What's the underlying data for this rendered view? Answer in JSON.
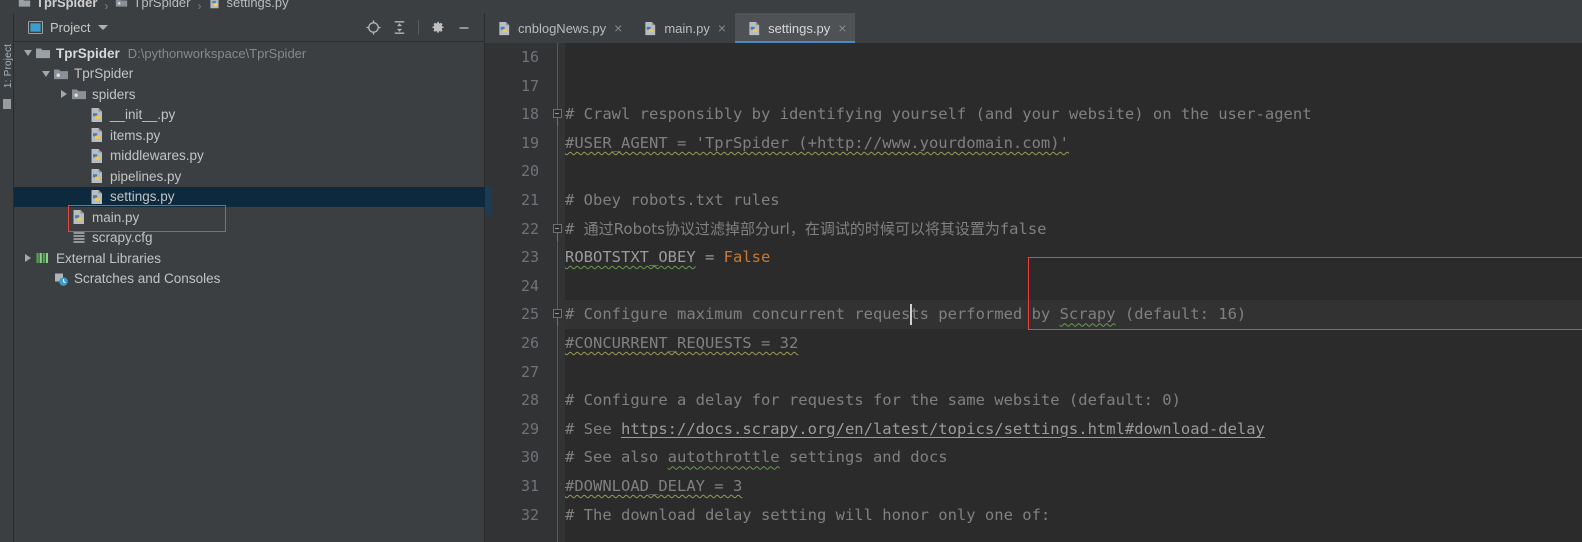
{
  "window": {
    "breadcrumb": [
      {
        "label": "TprSpider",
        "icon": "folder-icon",
        "bold": true
      },
      {
        "label": "TprSpider",
        "icon": "module-folder-icon",
        "bold": false
      },
      {
        "label": "settings.py",
        "icon": "python-file-icon",
        "bold": false
      }
    ],
    "separator": "›",
    "tool_window_label": "1: Project"
  },
  "project_panel": {
    "title": "Project",
    "title_icon": "project-view-icon",
    "dropdown_icon": "chevron-down-icon",
    "toolbar": [
      {
        "name": "locate-icon",
        "tooltip": "Select Opened File"
      },
      {
        "name": "collapse-all-icon",
        "tooltip": "Collapse All"
      },
      {
        "name": "gear-icon",
        "tooltip": "Settings"
      },
      {
        "name": "minimize-icon",
        "tooltip": "Hide"
      }
    ],
    "tree": [
      {
        "label": "TprSpider",
        "path": "D:\\pythonworkspace\\TprSpider",
        "icon": "folder-icon",
        "indent": 0,
        "arrow": "down",
        "bold": true,
        "selected": false
      },
      {
        "label": "TprSpider",
        "path": "",
        "icon": "module-folder-icon",
        "indent": 1,
        "arrow": "down",
        "bold": false,
        "selected": false
      },
      {
        "label": "spiders",
        "path": "",
        "icon": "module-folder-icon",
        "indent": 2,
        "arrow": "right",
        "bold": false,
        "selected": false
      },
      {
        "label": "__init__.py",
        "path": "",
        "icon": "python-file-icon",
        "indent": 3,
        "arrow": "none",
        "bold": false,
        "selected": false
      },
      {
        "label": "items.py",
        "path": "",
        "icon": "python-file-icon",
        "indent": 3,
        "arrow": "none",
        "bold": false,
        "selected": false
      },
      {
        "label": "middlewares.py",
        "path": "",
        "icon": "python-file-icon",
        "indent": 3,
        "arrow": "none",
        "bold": false,
        "selected": false
      },
      {
        "label": "pipelines.py",
        "path": "",
        "icon": "python-file-icon",
        "indent": 3,
        "arrow": "none",
        "bold": false,
        "selected": false
      },
      {
        "label": "settings.py",
        "path": "",
        "icon": "python-file-icon",
        "indent": 3,
        "arrow": "none",
        "bold": false,
        "selected": true
      },
      {
        "label": "main.py",
        "path": "",
        "icon": "python-file-icon",
        "indent": 2,
        "arrow": "none",
        "bold": false,
        "selected": false
      },
      {
        "label": "scrapy.cfg",
        "path": "",
        "icon": "config-file-icon",
        "indent": 2,
        "arrow": "none",
        "bold": false,
        "selected": false
      },
      {
        "label": "External Libraries",
        "path": "",
        "icon": "libraries-icon",
        "indent": 0,
        "arrow": "right",
        "bold": false,
        "selected": false
      },
      {
        "label": "Scratches and Consoles",
        "path": "",
        "icon": "scratches-icon",
        "indent": 1,
        "arrow": "none",
        "bold": false,
        "selected": false
      }
    ]
  },
  "editor": {
    "tabs": [
      {
        "label": "cnblogNews.py",
        "icon": "python-file-icon",
        "active": false,
        "close_icon": "close-icon"
      },
      {
        "label": "main.py",
        "icon": "python-file-icon",
        "active": false,
        "close_icon": "close-icon"
      },
      {
        "label": "settings.py",
        "icon": "python-file-icon",
        "active": true,
        "close_icon": "close-icon"
      }
    ],
    "first_line_number": 16,
    "current_line": 25,
    "lines": [
      {
        "n": "16",
        "text": ""
      },
      {
        "n": "17",
        "text": ""
      },
      {
        "n": "18",
        "text": "# Crawl responsibly by identifying yourself (and your website) on the user-agent"
      },
      {
        "n": "19",
        "text": "#USER_AGENT = 'TprSpider (+http://www.yourdomain.com)'"
      },
      {
        "n": "20",
        "text": ""
      },
      {
        "n": "21",
        "text": "# Obey robots.txt rules"
      },
      {
        "n": "22",
        "text": "# 通过Robots协议过滤掉部分url，在调试的时候可以将其设置为false"
      },
      {
        "n": "23",
        "text": "ROBOTSTXT_OBEY = False"
      },
      {
        "n": "24",
        "text": ""
      },
      {
        "n": "25",
        "text": "# Configure maximum concurrent requests performed by Scrapy (default: 16)"
      },
      {
        "n": "26",
        "text": "#CONCURRENT_REQUESTS = 32"
      },
      {
        "n": "27",
        "text": ""
      },
      {
        "n": "28",
        "text": "# Configure a delay for requests for the same website (default: 0)"
      },
      {
        "n": "29",
        "text": "# See https://docs.scrapy.org/en/latest/topics/settings.html#download-delay"
      },
      {
        "n": "30",
        "text": "# See also autothrottle settings and docs"
      },
      {
        "n": "31",
        "text": "#DOWNLOAD_DELAY = 3"
      },
      {
        "n": "32",
        "text": "# The download delay setting will honor only one of:"
      }
    ],
    "tokens": {
      "l22_hash": "# ",
      "l22_cjk": "通过Robots协议过滤掉部分url，在调试的时候可以将其设置为",
      "l22_false": "false",
      "l23_name": "ROBOTSTXT_OBEY",
      "l23_eq": " = ",
      "l23_value": "False",
      "l25_a": "# Configure maximum concurrent reques",
      "l25_b": "ts performed by ",
      "l25_scrapy": "Scrapy",
      "l25_c": " (default: 16)",
      "l29_a": "# See ",
      "l29_url": "https://docs.scrapy.org/en/latest/topics/settings.html#download-delay",
      "l30_a": "# See also ",
      "l30_word": "autothrottle",
      "l30_b": " settings and docs"
    }
  },
  "annotations": {
    "highlight_color": "#f1403f",
    "boxes": [
      {
        "name": "tree-settings-highlight",
        "target": "settings.py tree row"
      },
      {
        "name": "code-robotstxt-highlight",
        "target": "lines 22-23"
      }
    ]
  },
  "colors": {
    "panel_bg": "#3c3f41",
    "editor_bg": "#2b2b2b",
    "gutter_bg": "#313335",
    "selection_bg": "#0d293e",
    "tab_active_bg": "#4e5254",
    "tab_underline": "#4a88c7",
    "comment": "#808080",
    "keyword": "#cc7832",
    "identifier": "#9b9b9b"
  }
}
